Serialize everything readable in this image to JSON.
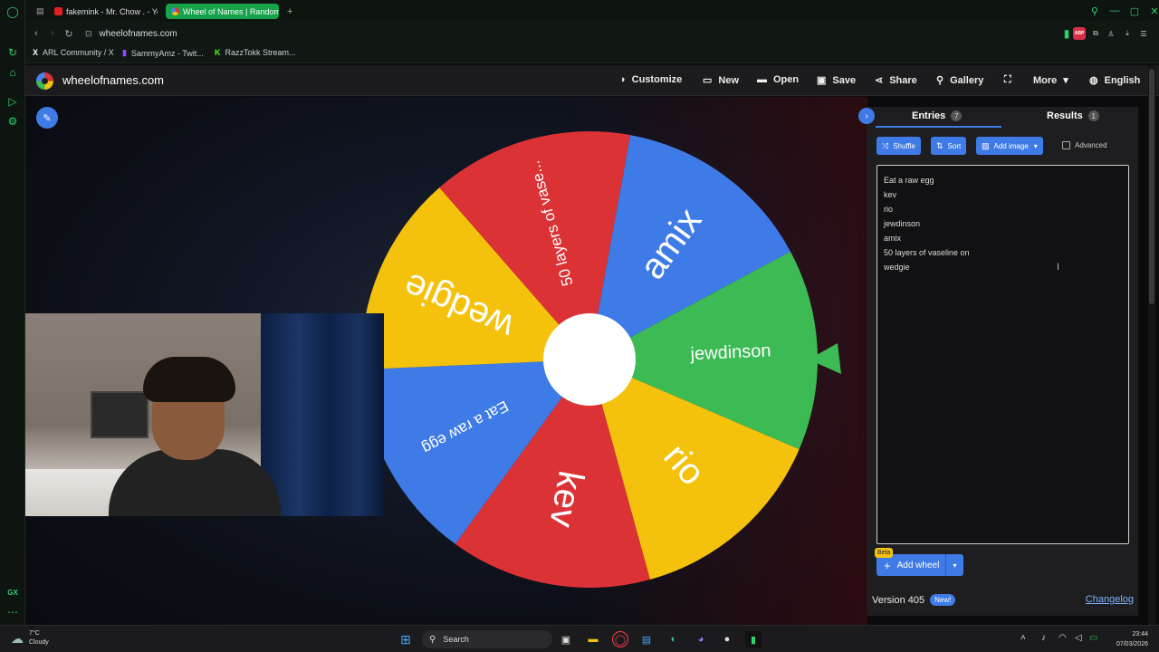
{
  "browser": {
    "tabs": [
      {
        "label": "fakemink - Mr. Chow . - Yo",
        "active": false
      },
      {
        "label": "Wheel of Names | Random",
        "active": true
      }
    ],
    "new_tab": "+",
    "url": "wheelofnames.com",
    "bookmarks": [
      {
        "label": "ARL Community / X",
        "icon": "X"
      },
      {
        "label": "SammyAmz - Twit...",
        "icon": "▮"
      },
      {
        "label": "RazzTokk Stream...",
        "icon": "K"
      }
    ]
  },
  "site": {
    "name": "wheelofnames.com",
    "menu": {
      "customize": "Customize",
      "new": "New",
      "open": "Open",
      "save": "Save",
      "share": "Share",
      "gallery": "Gallery",
      "more": "More",
      "language": "English"
    }
  },
  "wheel": {
    "segments": [
      {
        "label": "amix",
        "color": "#3e7be6"
      },
      {
        "label": "jewdinson",
        "color": "#3cba54"
      },
      {
        "label": "rio",
        "color": "#f4c20d"
      },
      {
        "label": "kev",
        "color": "#db3236"
      },
      {
        "label": "Eat a raw egg",
        "color": "#3e7be6"
      },
      {
        "label": "wedgie",
        "color": "#f4c20d"
      },
      {
        "label": "50 layers of vase...",
        "color": "#db3236"
      }
    ],
    "pointer_color": "#3cba54"
  },
  "panel": {
    "tabs": {
      "entries_label": "Entries",
      "entries_count": "7",
      "results_label": "Results",
      "results_count": "1"
    },
    "toolbar": {
      "shuffle": "Shuffle",
      "sort": "Sort",
      "add_image": "Add image",
      "advanced": "Advanced"
    },
    "entries": [
      "Eat a raw egg",
      "kev",
      "rio",
      "jewdinson",
      "amix",
      "50 layers of vaseline on",
      "wedgie"
    ],
    "beta": "Beta",
    "add_wheel": "Add wheel",
    "version": "Version 405",
    "new_badge": "New!",
    "changelog": "Changelog"
  },
  "taskbar": {
    "weather_temp": "7°C",
    "weather_desc": "Cloudy",
    "search_placeholder": "Search",
    "time": "23:44",
    "date": "07/03/2026"
  },
  "icons": {
    "pencil": "✎",
    "palette": "◑",
    "file": "▭",
    "folder": "▬",
    "save": "▣",
    "share": "⋖",
    "search": "⚲",
    "fullscreen": "⛶",
    "chevron_down": "▾",
    "globe": "◍",
    "chevron_right": "›",
    "shuffle": "⤨",
    "sort": "⇅",
    "image": "▨",
    "plus": "+",
    "cursor": "I"
  }
}
